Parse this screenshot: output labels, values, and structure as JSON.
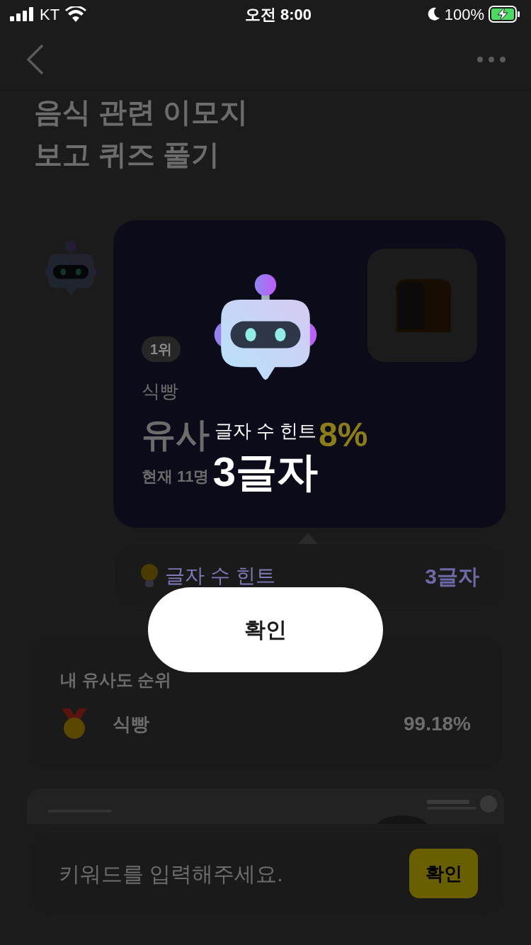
{
  "status_bar": {
    "carrier": "KT",
    "time": "오전 8:00",
    "battery": "100%"
  },
  "page": {
    "title_lines": [
      "음식 관련 이모지",
      "보고 퀴즈 풀기"
    ]
  },
  "result_card": {
    "rank": "1위",
    "word": "식빵",
    "similarity_label": "유사",
    "similarity_value": "8%",
    "people_text": "현재 11명"
  },
  "hint_row": {
    "label": "글자 수 힌트",
    "value": "3글자"
  },
  "ranking": {
    "title": "내 유사도 순위",
    "rows": [
      {
        "word": "식빵",
        "score": "99.18%"
      }
    ]
  },
  "input": {
    "placeholder": "키워드를 입력해주세요.",
    "button": "확인"
  },
  "modal": {
    "title": "글자 수 힌트",
    "value": "3글자",
    "button": "확인"
  }
}
